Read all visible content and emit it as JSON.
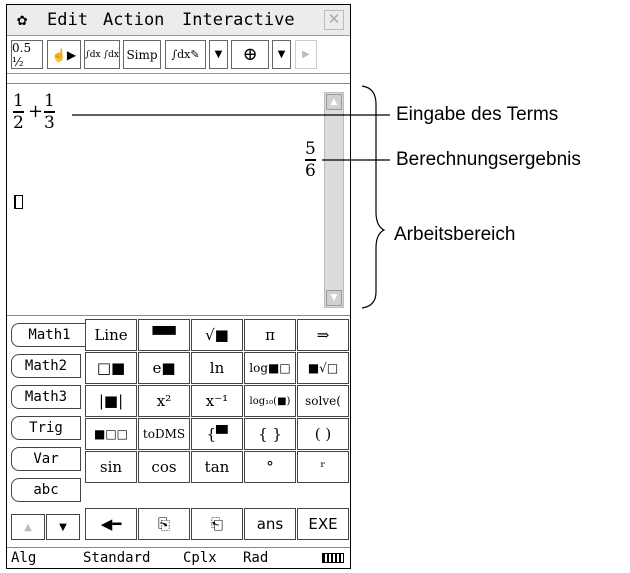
{
  "menu": {
    "items": [
      "Edit",
      "Action",
      "Interactive"
    ],
    "close_glyph": "✕"
  },
  "toolbar": {
    "buttons": [
      {
        "label": "0.5 ½",
        "icon": "fraction-convert-icon"
      },
      {
        "label": "☝▶",
        "icon": "drag-icon"
      },
      {
        "label": "∫dx ∫dx",
        "icon": "integral-toggle-icon"
      },
      {
        "label": "Simp",
        "icon": "simplify-icon"
      },
      {
        "label": "∫dx✎",
        "icon": "integral-edit-icon"
      },
      {
        "label": "▼",
        "icon": "dropdown-arrow-icon"
      },
      {
        "label": "⊕",
        "icon": "graph-icon"
      },
      {
        "label": "▼",
        "icon": "dropdown-arrow-icon"
      },
      {
        "label": "▶",
        "icon": "scroll-right-icon"
      }
    ]
  },
  "work": {
    "input": {
      "a_num": "1",
      "a_den": "2",
      "op": "+",
      "b_num": "1",
      "b_den": "3"
    },
    "result": {
      "num": "5",
      "den": "6"
    }
  },
  "keyboard": {
    "tabs": [
      "Math1",
      "Math2",
      "Math3",
      "Trig",
      "Var",
      "abc"
    ],
    "keys": [
      [
        "Line",
        "▀▀",
        "√■",
        "π",
        "⇒"
      ],
      [
        "□■",
        "e■",
        "ln",
        "log■□",
        "■√□"
      ],
      [
        "|■|",
        "x²",
        "x⁻¹",
        "log₁₀(■)",
        "solve("
      ],
      [
        "■□□",
        "toDMS",
        "{▀",
        "{ }",
        "( )"
      ],
      [
        "sin",
        "cos",
        "tan",
        "°",
        "ʳ"
      ],
      [
        "◀━",
        "⎘",
        "⎗",
        "ans",
        "EXE"
      ]
    ],
    "arrows": [
      "▲",
      "▼"
    ]
  },
  "status": {
    "items": [
      "Alg",
      "Standard",
      "Cplx",
      "Rad"
    ]
  },
  "annotations": {
    "input_label": "Eingabe des Terms",
    "result_label": "Berechnungsergebnis",
    "work_label": "Arbeitsbereich"
  }
}
